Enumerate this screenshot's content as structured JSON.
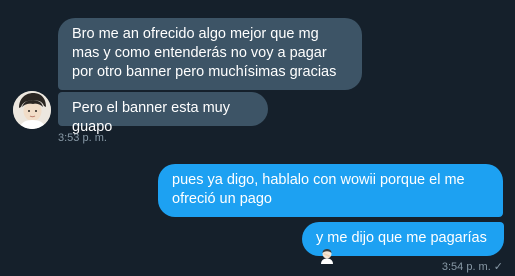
{
  "conversation": {
    "incoming": [
      {
        "text": "Bro me an ofrecido algo mejor que mg mas y como entenderás no voy a pagar por otro banner pero muchísimas gracias"
      },
      {
        "text": "Pero el banner esta muy guapo"
      }
    ],
    "incoming_time": "3:53 p. m.",
    "outgoing": [
      {
        "text": "pues ya digo, hablalo con wowii porque el me ofreció un pago"
      },
      {
        "text": "y me dijo que me pagarías",
        "emoji": "man-facepalming-icon"
      }
    ],
    "outgoing_time": "3:54 p. m.",
    "read_status": "✓"
  },
  "colors": {
    "background": "#15202b",
    "incoming_bubble": "#3d5466",
    "outgoing_bubble": "#1da1f2",
    "timestamp": "#8899a6"
  }
}
